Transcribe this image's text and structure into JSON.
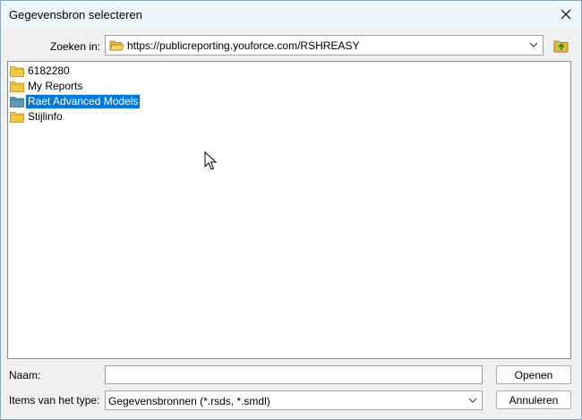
{
  "window": {
    "title": "Gegevensbron selecteren"
  },
  "lookin": {
    "label": "Zoeken in:",
    "path": "https://publicreporting.youforce.com/RSHREASY"
  },
  "filelist": {
    "items": [
      {
        "label": "6182280",
        "type": "folder",
        "selected": false
      },
      {
        "label": "My Reports",
        "type": "folder",
        "selected": false
      },
      {
        "label": "Raet Advanced Models",
        "type": "model-folder",
        "selected": true
      },
      {
        "label": "Stijlinfo",
        "type": "folder",
        "selected": false
      }
    ]
  },
  "name": {
    "label": "Naam:",
    "value": ""
  },
  "filetype": {
    "label": "Items van het type:",
    "selected": "Gegevensbronnen (*.rsds, *.smdl)"
  },
  "buttons": {
    "open": "Openen",
    "cancel": "Annuleren"
  },
  "colors": {
    "selection": "#0078d7",
    "titlebar": "#eef7fb",
    "folder": "#f5c842",
    "model_folder": "#5b9bb5"
  }
}
